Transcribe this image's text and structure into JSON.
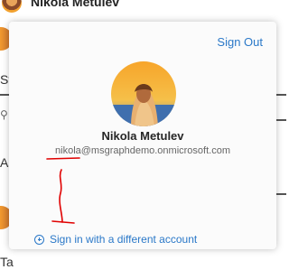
{
  "background": {
    "user_name": "Nikola Metulev",
    "left_fragments": [
      "St",
      "As",
      "Ta"
    ]
  },
  "flyout": {
    "sign_out_label": "Sign Out",
    "user_name": "Nikola Metulev",
    "user_email": "nikola@msgraphdemo.onmicrosoft.com",
    "sign_in_other_label": "Sign in with a different account"
  },
  "colors": {
    "link": "#2a78c8",
    "annotation": "#e00000"
  },
  "icons": {
    "add": "plus-circle-icon",
    "search": "search-icon"
  }
}
